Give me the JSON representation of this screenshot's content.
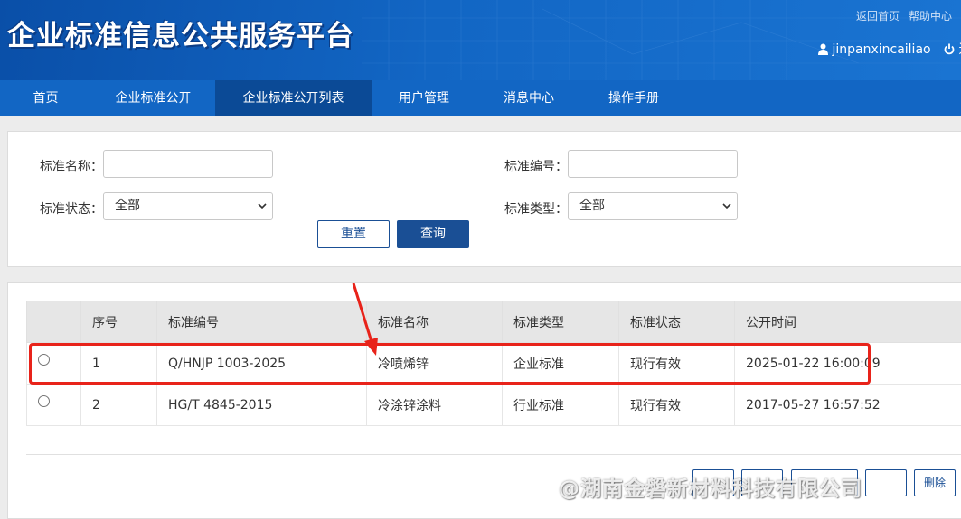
{
  "header": {
    "brand": "企业标准信息公共服务平台",
    "links": [
      "返回首页",
      "帮助中心"
    ],
    "username": "jinpanxincailiao",
    "logout": "退出"
  },
  "nav": {
    "items": [
      {
        "label": "首页"
      },
      {
        "label": "企业标准公开"
      },
      {
        "label": "企业标准公开列表"
      },
      {
        "label": "用户管理"
      },
      {
        "label": "消息中心"
      },
      {
        "label": "操作手册"
      }
    ],
    "active_index": 2
  },
  "search": {
    "name_label": "标准名称：",
    "name_value": "",
    "code_label": "标准编号：",
    "code_value": "",
    "status_label": "标准状态：",
    "status_selected": "全部",
    "type_label": "标准类型：",
    "type_selected": "全部",
    "reset_label": "重置",
    "query_label": "查询"
  },
  "table": {
    "columns": [
      "",
      "序号",
      "标准编号",
      "标准名称",
      "标准类型",
      "标准状态",
      "公开时间"
    ],
    "rows": [
      {
        "selected": false,
        "index": "1",
        "code": "Q/HNJP 1003-2025",
        "name": "冷喷烯锌",
        "type": "企业标准",
        "status": "现行有效",
        "time": "2025-01-22 16:00:09"
      },
      {
        "selected": false,
        "index": "2",
        "code": "HG/T 4845-2015",
        "name": "冷涂锌涂料",
        "type": "行业标准",
        "status": "现行有效",
        "time": "2017-05-27 16:57:52"
      }
    ]
  },
  "pager": {
    "buttons": [
      "",
      "",
      "",
      "",
      "删除"
    ]
  },
  "watermark": "@湖南金磐新材料科技有限公司",
  "colors": {
    "header": "#1266c4",
    "nav_active": "#0b4a96",
    "primary_button": "#1a4f95",
    "annotation": "#e8231a"
  }
}
